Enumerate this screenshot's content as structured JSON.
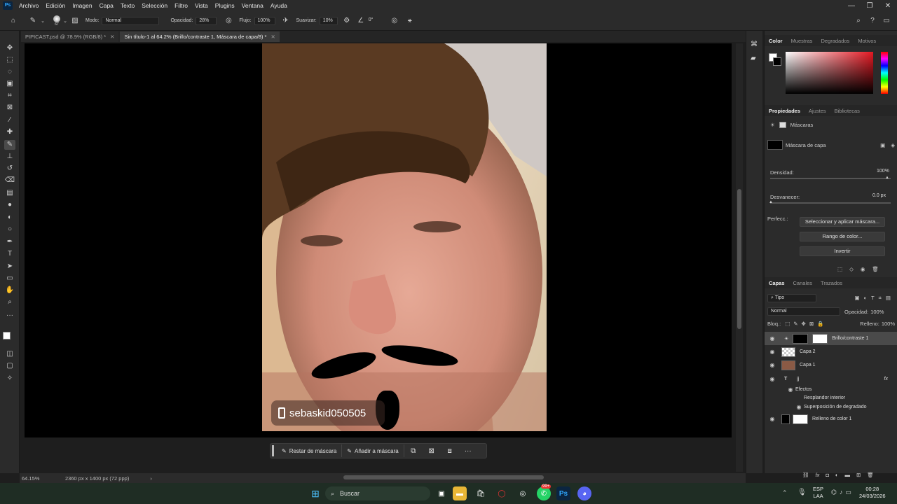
{
  "app": {
    "logo": "Ps"
  },
  "menu": [
    "Archivo",
    "Edición",
    "Imagen",
    "Capa",
    "Texto",
    "Selección",
    "Filtro",
    "Vista",
    "Plugins",
    "Ventana",
    "Ayuda"
  ],
  "window_controls": {
    "minimize": "—",
    "restore": "❐",
    "close": "✕"
  },
  "options": {
    "brush_size": "67",
    "mode_label": "Modo:",
    "mode_value": "Normal",
    "opacity_label": "Opacidad:",
    "opacity_value": "28%",
    "flow_label": "Flujo:",
    "flow_value": "100%",
    "smooth_label": "Suavizar:",
    "smooth_value": "10%",
    "angle_value": "0°"
  },
  "tabs": [
    {
      "label": "PIPICAST.psd @ 78.9% (RGB/8) *"
    },
    {
      "label": "Sin título-1 al 64.2% (Brillo/contraste 1, Máscara de capa/8) *"
    }
  ],
  "canvas": {
    "watermark_text": "sebaskid050505"
  },
  "context_bar": {
    "restore_mask": "Restar de máscara",
    "add_mask": "Añadir a máscara",
    "more": "···"
  },
  "status": {
    "zoom": "64.15%",
    "doc_info": "2360 px x 1400 px (72 ppp)"
  },
  "color_panel": {
    "tabs": [
      "Color",
      "Muestras",
      "Degradados",
      "Motivos"
    ]
  },
  "properties_panel": {
    "tabs": [
      "Propiedades",
      "Ajustes",
      "Bibliotecas"
    ],
    "masks_label": "Máscaras",
    "mask_name": "Máscara de capa",
    "density_label": "Densidad:",
    "density_value": "100%",
    "density_level": 1.0,
    "feather_label": "Desvanecer:",
    "feather_value": "0.0 px",
    "refine_label": "Perfecc.:",
    "btn_select": "Seleccionar y aplicar máscara...",
    "btn_color_range": "Rango de color...",
    "btn_invert": "Invertir"
  },
  "layers_panel": {
    "tabs": [
      "Capas",
      "Canales",
      "Trazados"
    ],
    "filter_kind": "Tipo",
    "blend_mode": "Normal",
    "opacity_label": "Opacidad:",
    "opacity_value": "100%",
    "lock_label": "Bloq.:",
    "fill_label": "Relleno:",
    "fill_value": "100%",
    "layers": [
      {
        "name": "Brillo/contraste 1"
      },
      {
        "name": "Capa 2"
      },
      {
        "name": "Capa 1"
      },
      {
        "name": "jj"
      },
      {
        "name": "Efectos"
      },
      {
        "name": "Resplandor interior"
      },
      {
        "name": "Superposición de degradado"
      },
      {
        "name": "Relleno de color 1"
      }
    ],
    "fx_label": "fx"
  },
  "taskbar": {
    "search_placeholder": "Buscar",
    "whatsapp_badge": "99+",
    "lang_top": "ESP",
    "lang_bottom": "LAA",
    "time": "00:28",
    "date": "24/03/2026"
  },
  "colors": {
    "accent": "#1473e6",
    "bg_dark": "#2b2b2b",
    "canvas": "#000000"
  }
}
